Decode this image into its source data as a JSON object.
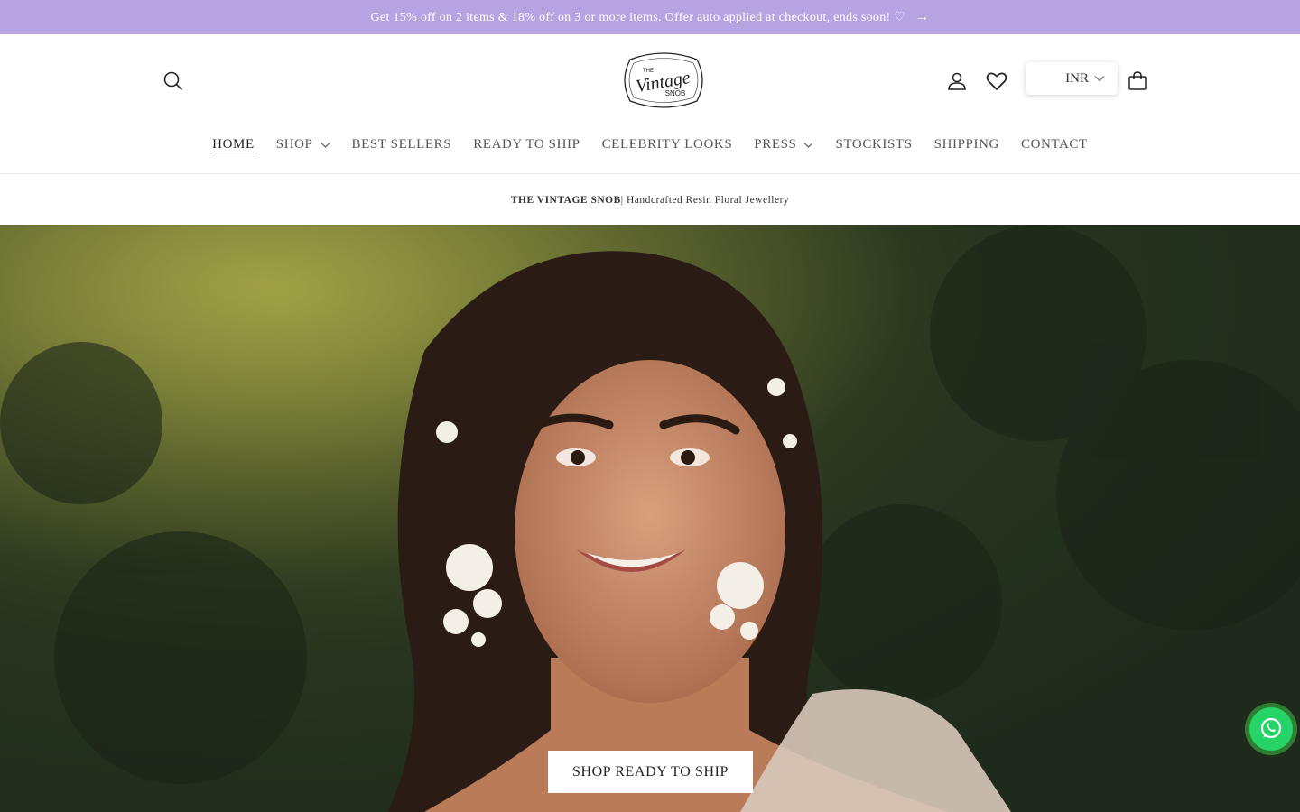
{
  "announcement": {
    "text": "Get 15% off on 2 items & 18% off on 3 or more items. Offer auto applied at checkout, ends soon! ♡",
    "arrow": "→"
  },
  "header": {
    "logo": {
      "line1": "THE",
      "line2": "Vintage",
      "line3": "SNOB"
    },
    "currency": "INR",
    "icons": [
      "search-icon",
      "account-icon",
      "heart-icon",
      "chevron-down-icon",
      "cart-icon"
    ]
  },
  "nav": {
    "items": [
      {
        "label": "HOME",
        "active": true
      },
      {
        "label": "SHOP",
        "dropdown": true
      },
      {
        "label": "BEST SELLERS"
      },
      {
        "label": "READY TO SHIP"
      },
      {
        "label": "CELEBRITY LOOKS"
      },
      {
        "label": "PRESS",
        "dropdown": true
      },
      {
        "label": "STOCKISTS"
      },
      {
        "label": "SHIPPING"
      },
      {
        "label": "CONTACT"
      }
    ]
  },
  "tagline": {
    "brand": "THE VINTAGE SNOB",
    "rest": " | Handcrafted Resin Floral Jewellery"
  },
  "hero": {
    "cta_label": "SHOP READY TO SHIP"
  },
  "colors": {
    "announcement_bg": "#b6a3e2",
    "whatsapp_green": "#25d366"
  }
}
